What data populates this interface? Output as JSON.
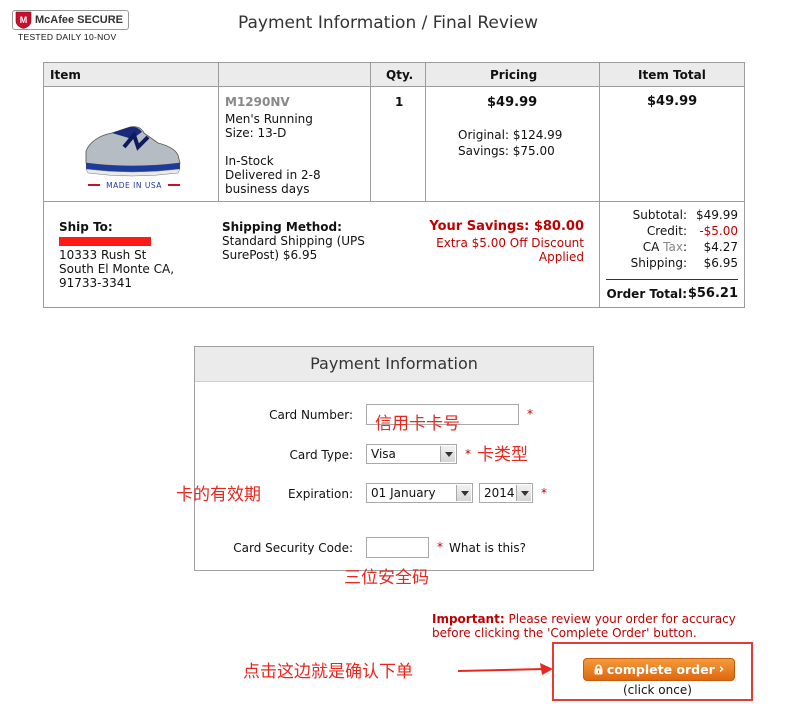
{
  "badge": {
    "brand": "McAfee SECURE",
    "subtitle": "TESTED DAILY   10-NOV",
    "icon": "mcafee-shield-icon"
  },
  "page_title": "Payment Information / Final Review",
  "order_table": {
    "headers": {
      "item": "Item",
      "qty": "Qty.",
      "pricing": "Pricing",
      "item_total": "Item Total"
    },
    "item": {
      "image_caption": "MADE IN USA",
      "sku": "M1290NV",
      "name": "Men's Running",
      "size": "Size: 13-D",
      "stock": "In-Stock",
      "delivery_1": "Delivered in 2-8",
      "delivery_2": "business days",
      "qty": "1",
      "price": "$49.99",
      "original": "Original: $124.99",
      "savings": "Savings: $75.00",
      "item_total": "$49.99"
    },
    "ship_to": {
      "label": "Ship To:",
      "address_1": "10333 Rush St",
      "address_2": "South El Monte CA,",
      "address_3": "91733-3341"
    },
    "shipping_method": {
      "label": "Shipping Method:",
      "line_1": "Standard Shipping (UPS",
      "line_2": "SurePost) $6.95"
    },
    "your_savings": {
      "label": "Your Savings: $80.00",
      "line_1": "Extra $5.00 Off Discount",
      "line_2": "Applied"
    },
    "totals": {
      "subtotal_label": "Subtotal:",
      "subtotal": "$49.99",
      "credit_label": "Credit:",
      "credit": "-$5.00",
      "tax_state": "CA",
      "tax_label": "Tax",
      "tax": "$4.27",
      "shipping_label": "Shipping:",
      "shipping": "$6.95",
      "order_total_label": "Order Total:",
      "order_total": "$56.21"
    }
  },
  "payment": {
    "title": "Payment Information",
    "card_number_label": "Card Number:",
    "card_type_label": "Card Type:",
    "card_type_value": "Visa",
    "expiration_label": "Expiration:",
    "exp_month": "01 January",
    "exp_year": "2014",
    "cvv_label": "Card Security Code:",
    "what_is_this": "What is this?",
    "required_mark": "*"
  },
  "annotations": {
    "card_number": "信用卡卡号",
    "card_type": "卡类型",
    "expiration": "卡的有效期",
    "cvv": "三位安全码",
    "complete": "点击这边就是确认下单"
  },
  "important": {
    "label": "Important:",
    "text": " Please review your order for accuracy before clicking the 'Complete Order' button."
  },
  "complete_button": {
    "label": "complete order",
    "note": "(click once)"
  },
  "colors": {
    "accent_red": "#c00000",
    "annotation_red": "#e8271f",
    "button_orange": "#e8761e"
  }
}
